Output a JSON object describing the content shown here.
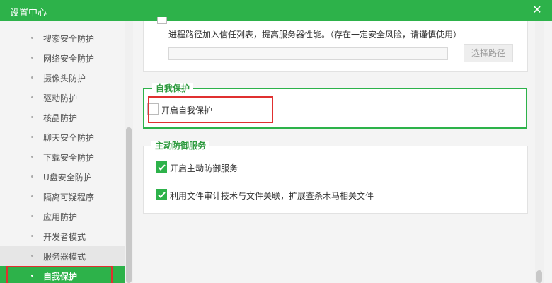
{
  "window": {
    "title": "设置中心",
    "close_symbol": "✕"
  },
  "sidebar": {
    "items": [
      {
        "label": "搜索安全防护"
      },
      {
        "label": "网络安全防护"
      },
      {
        "label": "摄像头防护"
      },
      {
        "label": "驱动防护"
      },
      {
        "label": "核晶防护"
      },
      {
        "label": "聊天安全防护"
      },
      {
        "label": "下载安全防护"
      },
      {
        "label": "U盘安全防护"
      },
      {
        "label": "隔离可疑程序"
      },
      {
        "label": "应用防护"
      },
      {
        "label": "开发者模式"
      },
      {
        "label": "服务器模式"
      },
      {
        "label": "自我保护"
      }
    ]
  },
  "server_mode": {
    "description": "进程路径加入信任列表，提高服务器性能。（存在一定安全风险，请谨慎使用）",
    "path_value": "",
    "choose_path_label": "选择路径"
  },
  "self_protect": {
    "title": "自我保护",
    "option_label": "开启自我保护",
    "checked": false
  },
  "active_defense": {
    "title": "主动防御服务",
    "options": [
      {
        "label": "开启主动防御服务",
        "checked": true
      },
      {
        "label": "利用文件审计技术与文件关联，扩展查杀木马相关文件",
        "checked": true
      }
    ]
  },
  "colors": {
    "brand": "#2db24a",
    "highlight": "#e03030"
  }
}
